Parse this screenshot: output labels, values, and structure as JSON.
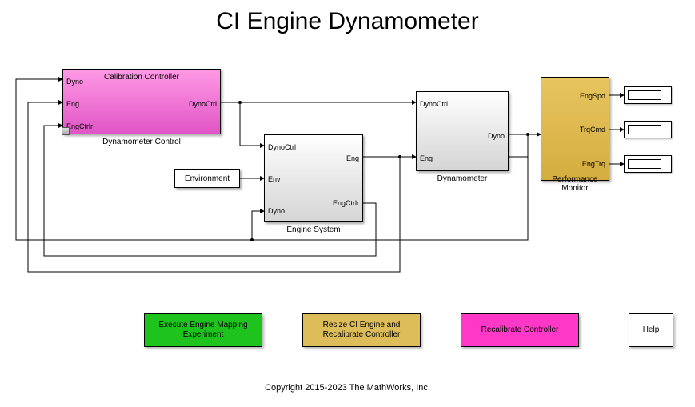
{
  "title": "CI Engine Dynamometer",
  "copyright": "Copyright 2015-2023 The MathWorks, Inc.",
  "blocks": {
    "calib": {
      "top_label": "Calibration Controller",
      "caption": "Dynamometer Control",
      "ports_left": [
        "Dyno",
        "Eng",
        "EngCtrlr"
      ],
      "ports_right": [
        "DynoCtrl"
      ]
    },
    "env": {
      "label": "Environment"
    },
    "engsys": {
      "caption": "Engine System",
      "ports_left": [
        "DynoCtrl",
        "Env",
        "Dyno"
      ],
      "ports_right": [
        "Eng",
        "EngCtrlr"
      ]
    },
    "dyno": {
      "caption": "Dynamometer",
      "ports_left": [
        "DynoCtrl",
        "Eng"
      ],
      "ports_right": [
        "Dyno"
      ]
    },
    "perf": {
      "caption": "Performance Monitor",
      "ports_right": [
        "EngSpd",
        "TrqCmd",
        "EngTrq"
      ]
    }
  },
  "buttons": {
    "exec": "Execute Engine Mapping\nExperiment",
    "resize": "Resize CI Engine and\nRecalibrate Controller",
    "recal": "Recalibrate Controller",
    "help": "Help"
  }
}
